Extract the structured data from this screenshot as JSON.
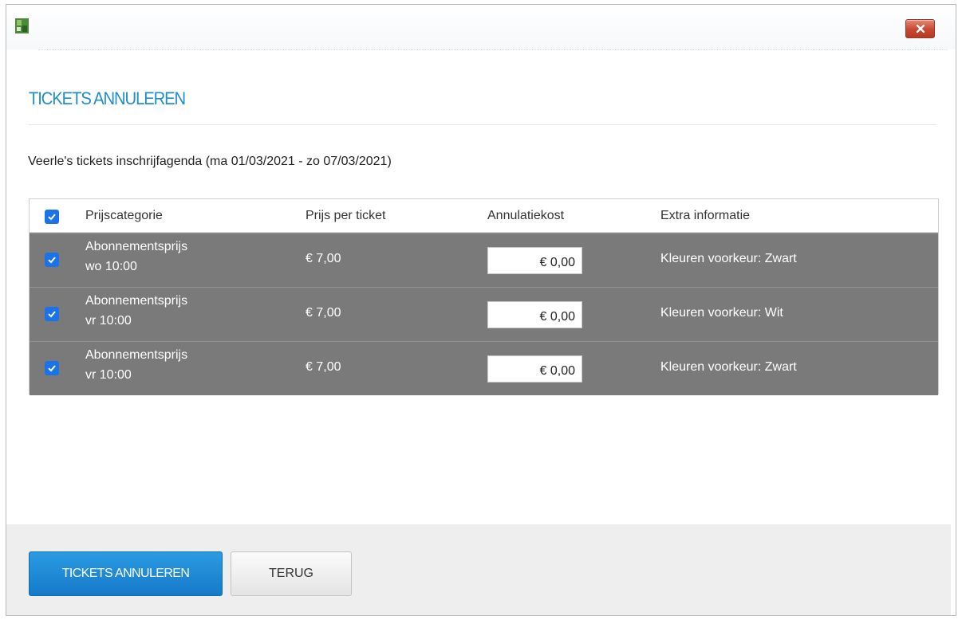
{
  "window": {
    "close_label": "x"
  },
  "page": {
    "title": "TICKETS ANNULEREN",
    "subtitle": "Veerle's tickets inschrijfagenda (ma 01/03/2021 - zo 07/03/2021)"
  },
  "table": {
    "select_all_checked": true,
    "columns": [
      "Prijscategorie",
      "Prijs per ticket",
      "Annulatiekost",
      "Extra informatie"
    ],
    "rows": [
      {
        "checked": true,
        "category": "Abonnementsprijs",
        "time": "wo 10:00",
        "price": "€ 7,00",
        "cost": "€ 0,00",
        "extra": "Kleuren voorkeur: Zwart"
      },
      {
        "checked": true,
        "category": "Abonnementsprijs",
        "time": "vr 10:00",
        "price": "€ 7,00",
        "cost": "€ 0,00",
        "extra": "Kleuren voorkeur: Wit"
      },
      {
        "checked": true,
        "category": "Abonnementsprijs",
        "time": "vr 10:00",
        "price": "€ 7,00",
        "cost": "€ 0,00",
        "extra": "Kleuren voorkeur: Zwart"
      }
    ]
  },
  "actions": {
    "confirm_label": "TICKETS ANNULEREN",
    "back_label": "TERUG"
  },
  "colors": {
    "accent": "#1f8ecb",
    "primary_button": "#1a80cf",
    "row_background": "#7a7a7a",
    "checkbox": "#1a73e8",
    "close_button": "#c9472f"
  }
}
